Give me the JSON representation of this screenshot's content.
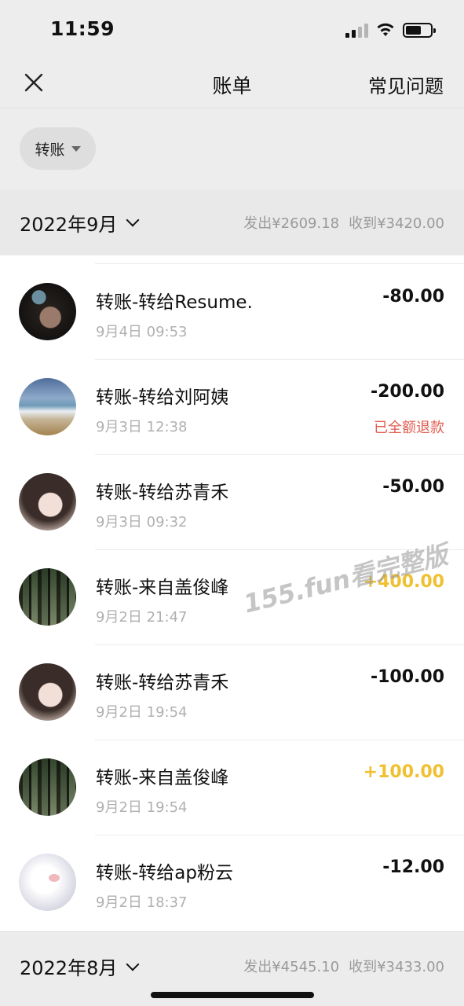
{
  "status_bar": {
    "time": "11:59"
  },
  "nav": {
    "title": "账单",
    "faq": "常见问题"
  },
  "filter": {
    "label": "转账"
  },
  "months": [
    {
      "label": "2022年9月",
      "spent": "发出¥2609.18",
      "received": "收到¥3420.00"
    },
    {
      "label": "2022年8月",
      "spent": "发出¥4545.10",
      "received": "收到¥3433.00"
    }
  ],
  "transactions": [
    {
      "title": "转账-转给Resume.",
      "time": "9月4日 09:53",
      "amount": "-80.00",
      "status": "",
      "avatar": "dark-portrait"
    },
    {
      "title": "转账-转给刘阿姨",
      "time": "9月3日 12:38",
      "amount": "-200.00",
      "status": "已全额退款",
      "avatar": "beach"
    },
    {
      "title": "转账-转给苏青禾",
      "time": "9月3日 09:32",
      "amount": "-50.00",
      "status": "",
      "avatar": "girl-portrait"
    },
    {
      "title": "转账-来自盖俊峰",
      "time": "9月2日 21:47",
      "amount": "+400.00",
      "status": "",
      "avatar": "forest"
    },
    {
      "title": "转账-转给苏青禾",
      "time": "9月2日 19:54",
      "amount": "-100.00",
      "status": "",
      "avatar": "girl-portrait"
    },
    {
      "title": "转账-来自盖俊峰",
      "time": "9月2日 19:54",
      "amount": "+100.00",
      "status": "",
      "avatar": "forest"
    },
    {
      "title": "转账-转给ap粉云",
      "time": "9月2日 18:37",
      "amount": "-12.00",
      "status": "",
      "avatar": "cat"
    }
  ],
  "watermark": "155.fun看完整版",
  "colors": {
    "income": "#f0c030",
    "refund": "#e05d4f",
    "secondary_text": "#b0b0b0",
    "background": "#ededed"
  }
}
